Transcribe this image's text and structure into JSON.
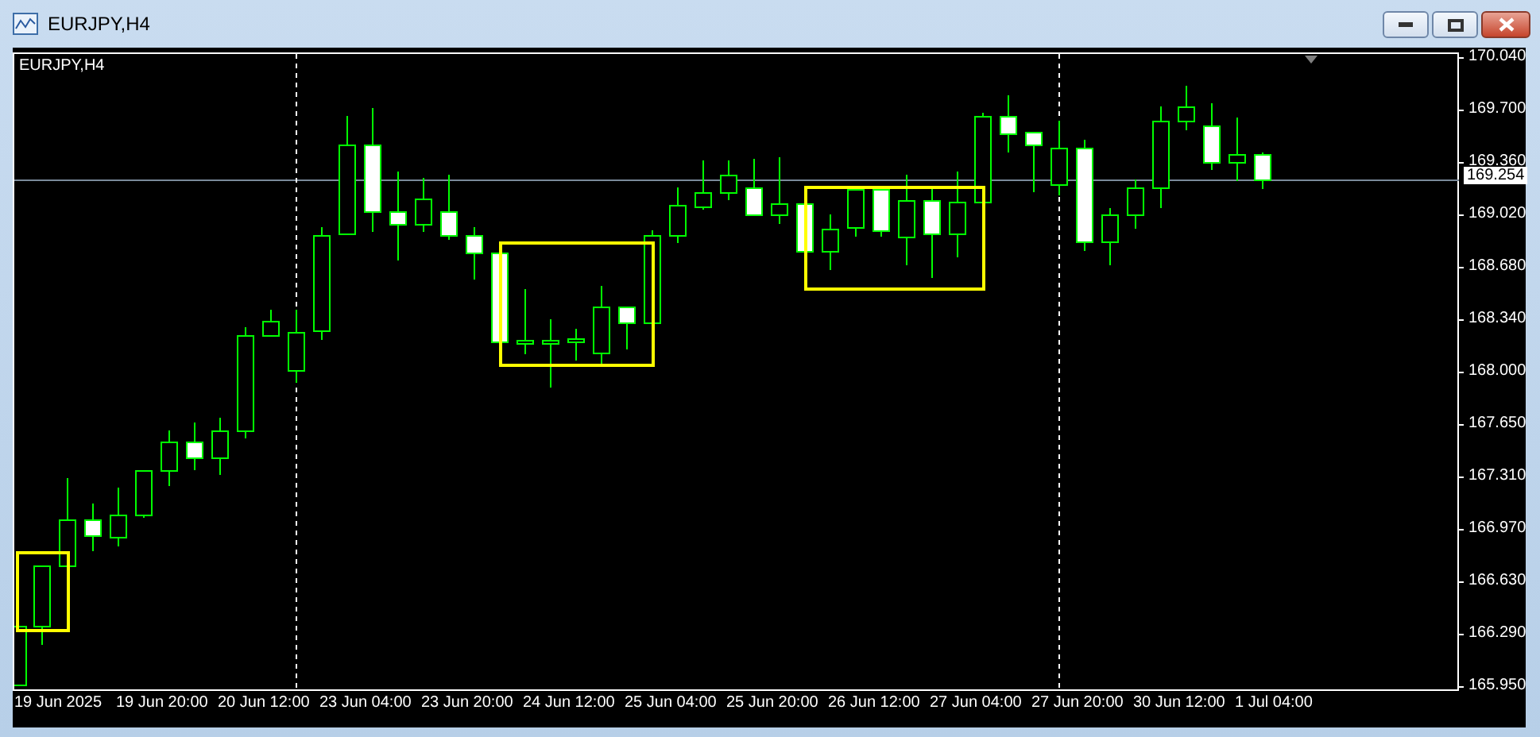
{
  "window": {
    "title": "EURJPY,H4"
  },
  "chart": {
    "symbol_label": "EURJPY,H4",
    "price_labels": [
      "170.040",
      "169.700",
      "169.360",
      "169.020",
      "168.680",
      "168.340",
      "168.000",
      "167.650",
      "167.310",
      "166.970",
      "166.630",
      "166.290",
      "165.950"
    ],
    "current_price": "169.254",
    "time_labels": [
      "19 Jun 2025",
      "19 Jun 20:00",
      "20 Jun 12:00",
      "23 Jun 04:00",
      "23 Jun 20:00",
      "24 Jun 12:00",
      "25 Jun 04:00",
      "25 Jun 20:00",
      "26 Jun 12:00",
      "27 Jun 04:00",
      "27 Jun 20:00",
      "30 Jun 12:00",
      "1 Jul 04:00"
    ]
  }
}
